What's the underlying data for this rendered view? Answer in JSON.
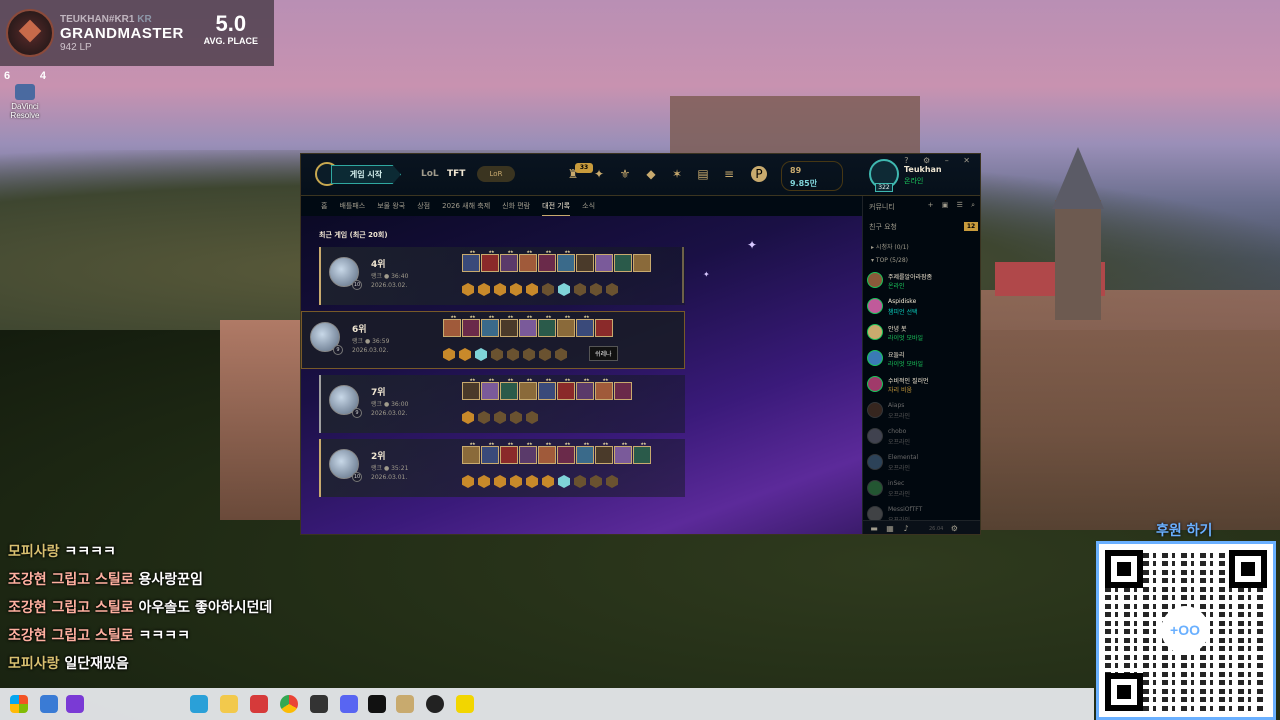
{
  "overlay": {
    "riot_id": "TEUKHAN",
    "riot_tag": "#KR1",
    "region": "KR",
    "tier": "GRANDMASTER",
    "lp": "942 LP",
    "avg_place": "5.0",
    "avg_place_label": "AVG. PLACE"
  },
  "desktop_icon": {
    "badge_left": "6",
    "badge_right": "4",
    "label": "DaVinci Resolve"
  },
  "client": {
    "play_button": "게임 시작",
    "mode_tabs": [
      "LoL",
      "TFT"
    ],
    "lol_pill": "LoR",
    "tokens_badge": "33",
    "currency_rp": "89",
    "currency_be": "9.85만",
    "profile_level": "322",
    "profile_name": "Teukhan",
    "profile_status": "온라인",
    "subnav": [
      "홈",
      "배틀패스",
      "보물 왕국",
      "상점",
      "2026 새해 축제",
      "신화 편람",
      "대전 기록",
      "소식"
    ],
    "subnav_active": "대전 기록",
    "recent_title": "최근 게임 (최근 20회)",
    "tooltip": "쉬레나",
    "matches": [
      {
        "place": "4위",
        "mode": "랭크 ● 36:40",
        "date": "2026.03.02.",
        "level": "10",
        "units": 10,
        "traits": [
          "gold",
          "gold",
          "gold",
          "gold",
          "gold",
          "bronze",
          "prism",
          "bronze",
          "bronze",
          "bronze"
        ],
        "stars": [
          "★★",
          "★★",
          "★★",
          "★★",
          "★★",
          "★★",
          "",
          "",
          "",
          ""
        ]
      },
      {
        "place": "6위",
        "mode": "랭크 ● 36:59",
        "date": "2026.03.02.",
        "level": "9",
        "units": 9,
        "traits": [
          "gold",
          "gold",
          "prism",
          "bronze",
          "bronze",
          "bronze",
          "bronze",
          "bronze"
        ],
        "stars": [
          "★★",
          "★★",
          "★★",
          "★★",
          "★★",
          "★★",
          "★★",
          "★★",
          ""
        ]
      },
      {
        "place": "7위",
        "mode": "랭크 ● 36:00",
        "date": "2026.03.02.",
        "level": "9",
        "units": 9,
        "traits": [
          "gold",
          "bronze",
          "bronze",
          "bronze",
          "bronze"
        ],
        "stars": [
          "★★",
          "★★",
          "★★",
          "★★",
          "★★",
          "★★",
          "★★",
          "★★",
          ""
        ]
      },
      {
        "place": "2위",
        "mode": "랭크 ● 35:21",
        "date": "2026.03.01.",
        "level": "10",
        "units": 10,
        "traits": [
          "gold",
          "gold",
          "gold",
          "gold",
          "gold",
          "gold",
          "prism",
          "bronze",
          "bronze",
          "bronze"
        ],
        "stars": [
          "★★",
          "★★",
          "★★",
          "★★",
          "★★",
          "★★",
          "★★",
          "★★",
          "★★",
          "★★"
        ]
      }
    ]
  },
  "social": {
    "header": "커뮤니티",
    "friend_requests": "친구 요청",
    "request_count": "12",
    "group_spectator": "시청자 (0/1)",
    "group_top": "TOP (5/28)",
    "friends": [
      {
        "name": "주제를알아라잠좀",
        "status": "온라인",
        "state": "online"
      },
      {
        "name": "Aspidiske",
        "status": "챔피언 선택",
        "state": "online"
      },
      {
        "name": "안녕 봇",
        "status": "라이엇 모바일",
        "state": "online"
      },
      {
        "name": "요들리",
        "status": "라이엇 모바일",
        "state": "online"
      },
      {
        "name": "수비적인 질러먼",
        "status": "자리 비움",
        "state": "online"
      },
      {
        "name": "Aiaps",
        "status": "오프라인",
        "state": "offline"
      },
      {
        "name": "chobo",
        "status": "오프라인",
        "state": "offline"
      },
      {
        "name": "Elemental",
        "status": "오프라인",
        "state": "offline"
      },
      {
        "name": "inSec",
        "status": "오프라인",
        "state": "offline"
      },
      {
        "name": "MessiOfTFT",
        "status": "오프라인",
        "state": "offline"
      }
    ],
    "version": "26.04"
  },
  "chat": [
    {
      "name": "모피사랑",
      "msg": "ㅋㅋㅋㅋ",
      "style": "alt"
    },
    {
      "name": "조강현 그립고 스틸로",
      "msg": "용사랑꾼임",
      "style": "main"
    },
    {
      "name": "조강현 그립고 스틸로",
      "msg": "아우솔도 좋아하시던데",
      "style": "main"
    },
    {
      "name": "조강현 그립고 스틸로",
      "msg": "ㅋㅋㅋㅋ",
      "style": "main"
    },
    {
      "name": "모피사랑",
      "msg": "일단재밌음",
      "style": "alt"
    }
  ],
  "donation": {
    "label": "후원 하기",
    "qr_text": "+OO"
  },
  "colors": {
    "gold": "#c8aa6e",
    "teal": "#3fb8b0",
    "online": "#1ac55b",
    "donate_blue": "#6ab0ff"
  }
}
